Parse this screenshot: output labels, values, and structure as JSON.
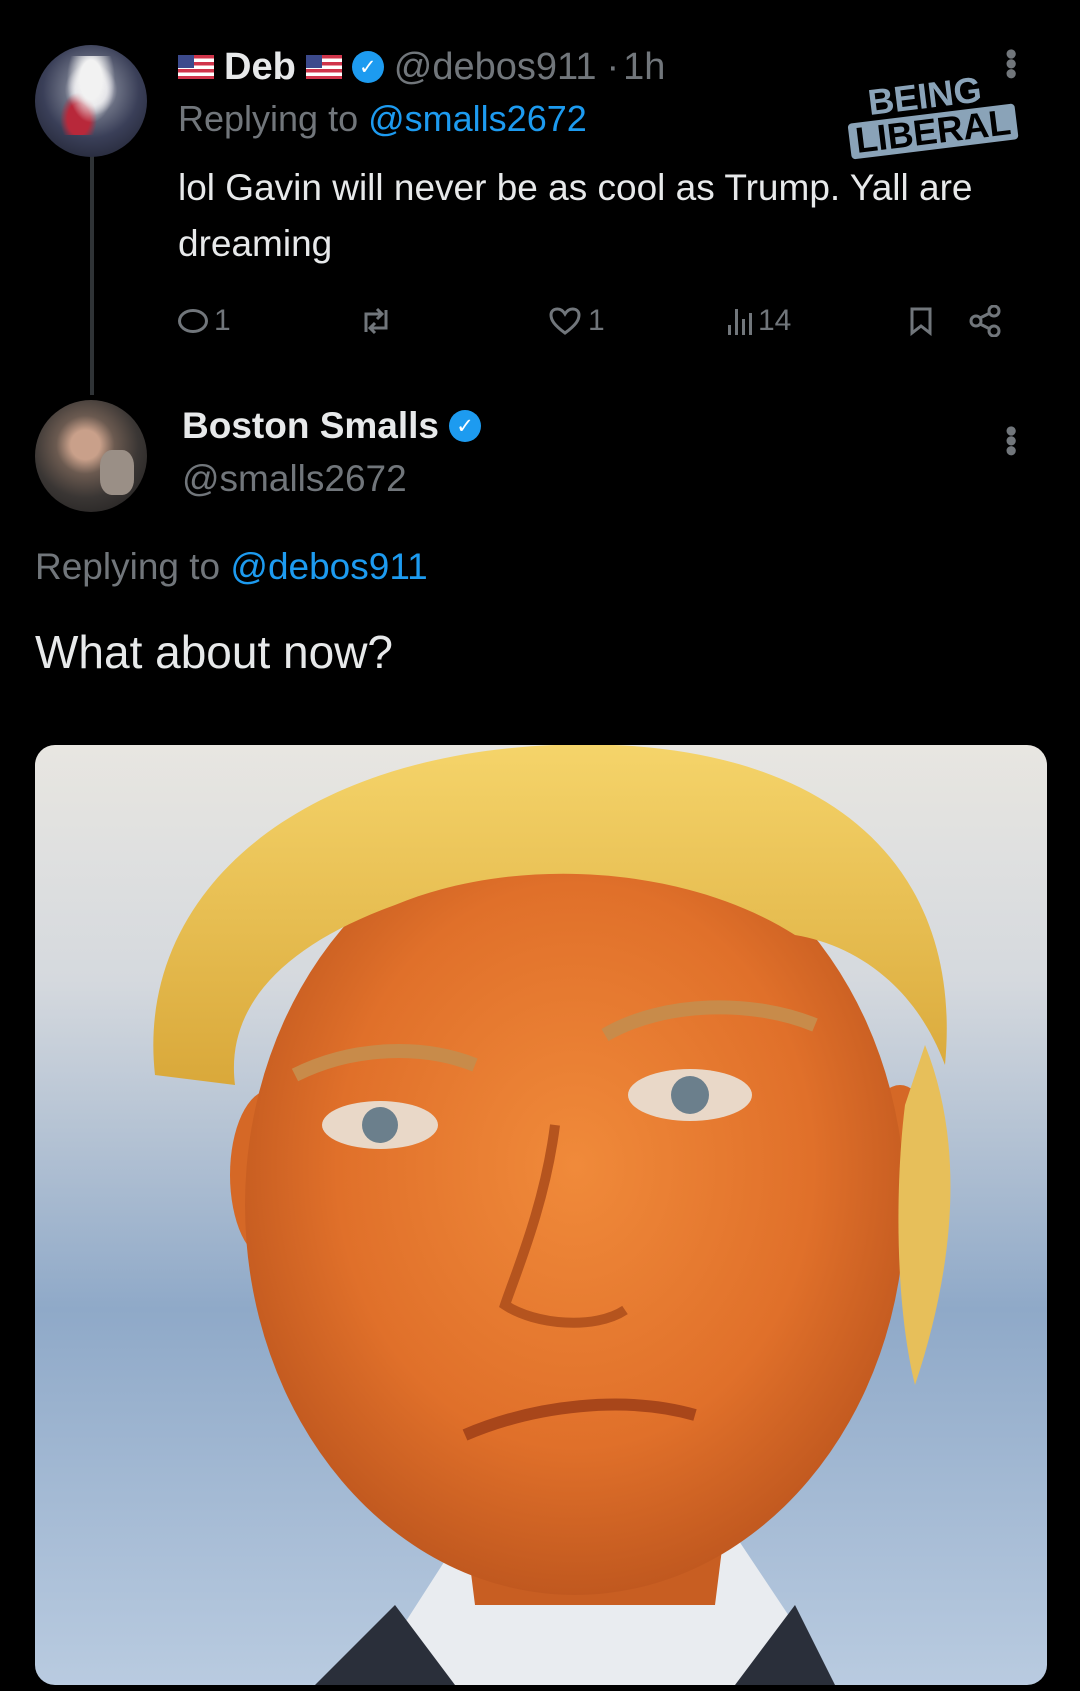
{
  "tweet1": {
    "display_name": "Deb",
    "handle": "@debos911",
    "separator": "·",
    "time": "1h",
    "replying_prefix": "Replying to",
    "replying_handle": "@smalls2672",
    "text": "lol Gavin will never be as cool as Trump. Yall are dreaming",
    "more_icon": "more-icon",
    "actions": {
      "replies": "1",
      "retweets": "",
      "likes": "1",
      "views": "14"
    }
  },
  "watermark": {
    "line1": "BEING",
    "line2": "LIBERAL"
  },
  "tweet2": {
    "display_name": "Boston Smalls",
    "handle": "@smalls2672",
    "replying_prefix": "Replying to",
    "replying_handle": "@debos911",
    "text": "What about now?",
    "more_icon": "more-icon"
  },
  "colors": {
    "background": "#000000",
    "text": "#e7e9ea",
    "muted": "#71767b",
    "link": "#1d9bf0",
    "verified": "#1d9bf0"
  }
}
